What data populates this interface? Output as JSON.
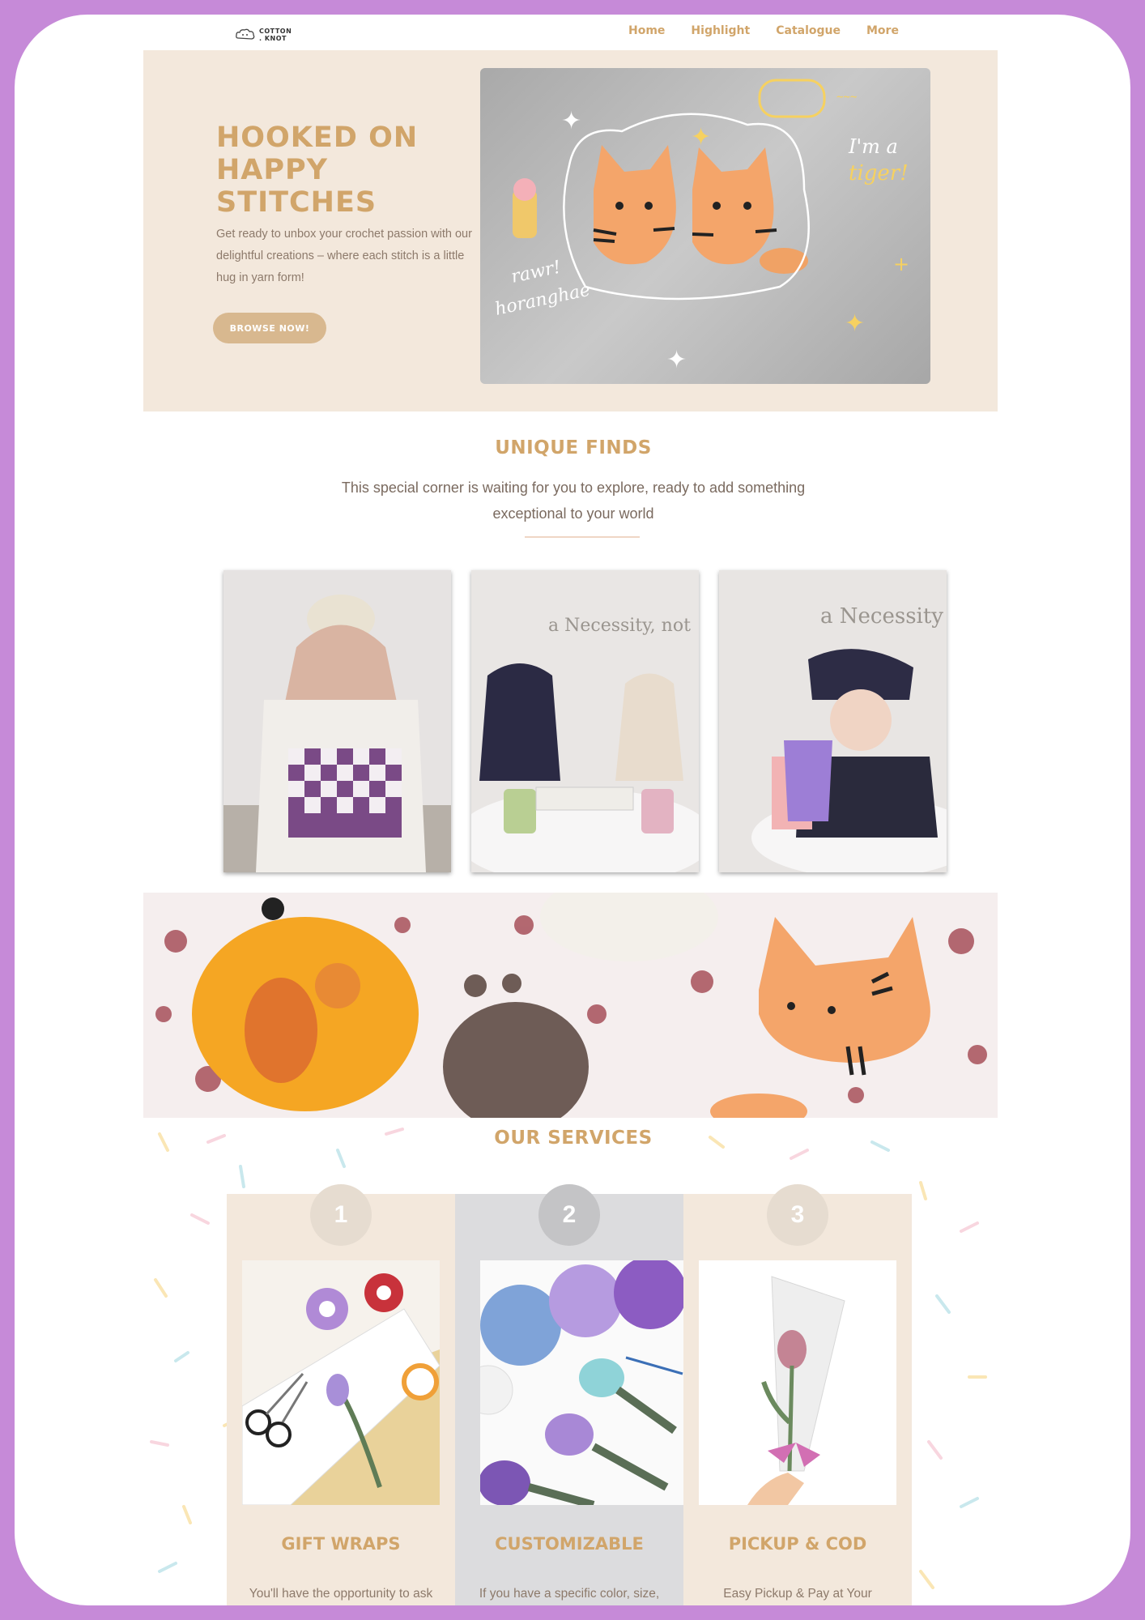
{
  "header": {
    "logo_text_line1": "COTTON",
    "logo_text_line2": ". KNOT",
    "nav": [
      "Home",
      "Highlight",
      "Catalogue",
      "More"
    ]
  },
  "hero": {
    "title": "HOOKED ON HAPPY STITCHES",
    "description": "Get ready to unbox your crochet passion with our delightful creations – where each stitch is a little hug in yarn form!",
    "button_label": "BROWSE NOW!",
    "image_doodles": [
      "rawr!",
      "horanghae",
      "I'm a",
      "tiger!"
    ]
  },
  "unique_finds": {
    "title": "UNIQUE FINDS",
    "description": "This special corner is waiting for you to explore, ready to add something exceptional to your world",
    "wall_text_1": "a Necessity, not",
    "wall_text_2": "a Necessity"
  },
  "services": {
    "title": "OUR SERVICES",
    "cards": [
      {
        "number": "1",
        "title": "GIFT WRAPS",
        "desc": "You'll have the opportunity to ask for cute wrapping"
      },
      {
        "number": "2",
        "title": "CUSTOMIZABLE",
        "desc": "If you have a specific color, size, pattern or design in"
      },
      {
        "number": "3",
        "title": "PICKUP & COD",
        "desc": "Easy Pickup & Pay at Your Doorstep. Start shopping"
      }
    ]
  },
  "colors": {
    "accent": "#d1a56a",
    "hero_bg": "#f3e8dc",
    "frame": "#c68ad8",
    "card_bg": "#f3e8dc",
    "card_alt_bg": "#dcdcde"
  }
}
